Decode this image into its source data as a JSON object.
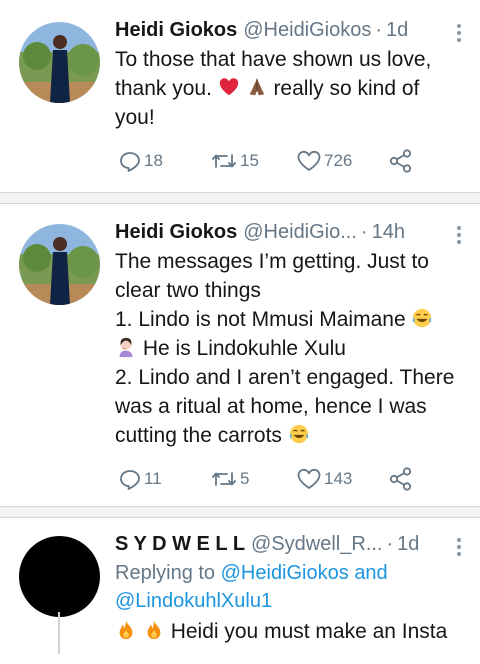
{
  "tweets": [
    {
      "name": "Heidi Giokos",
      "handle": "@HeidiGiokos",
      "dot": "·",
      "time": "1d",
      "line1": "To those that have shown us love,",
      "line2a": "thank you.",
      "line2b": "really so kind of",
      "line3": "you!",
      "emojis": [
        "red-heart-emoji",
        "folded-hands-emoji"
      ],
      "replies": "18",
      "retweets": "15",
      "likes": "726"
    },
    {
      "name": "Heidi Giokos",
      "handle": "@HeidiGio...",
      "dot": "·",
      "time": "14h",
      "line1": "The messages I’m getting. Just to",
      "line2": "clear two things",
      "line3": "1. Lindo is not Mmusi Maimane",
      "line4": "He is Lindokuhle Xulu",
      "line5": "2. Lindo and I aren’t engaged. There",
      "line6": "was a ritual at home, hence I was",
      "line7": "cutting the carrots",
      "emojis": [
        "tears-of-joy-emoji",
        "woman-shrugging-emoji"
      ],
      "replies": "11",
      "retweets": "5",
      "likes": "143"
    },
    {
      "name": "S Y D W E L L",
      "handle": "@Sydwell_R...",
      "dot": "·",
      "time": "1d",
      "replying_to": "Replying to",
      "mention1": "@HeidiGiokos",
      "and": "and",
      "mention2": "@LindokuhlXulu1",
      "line1": "Heidi you must make an Insta",
      "emojis": [
        "fire-emoji"
      ]
    }
  ],
  "colors": {
    "name": "#14171a",
    "secondary": "#657786",
    "link": "#1b95e0",
    "divider": "#d3d6d9"
  }
}
